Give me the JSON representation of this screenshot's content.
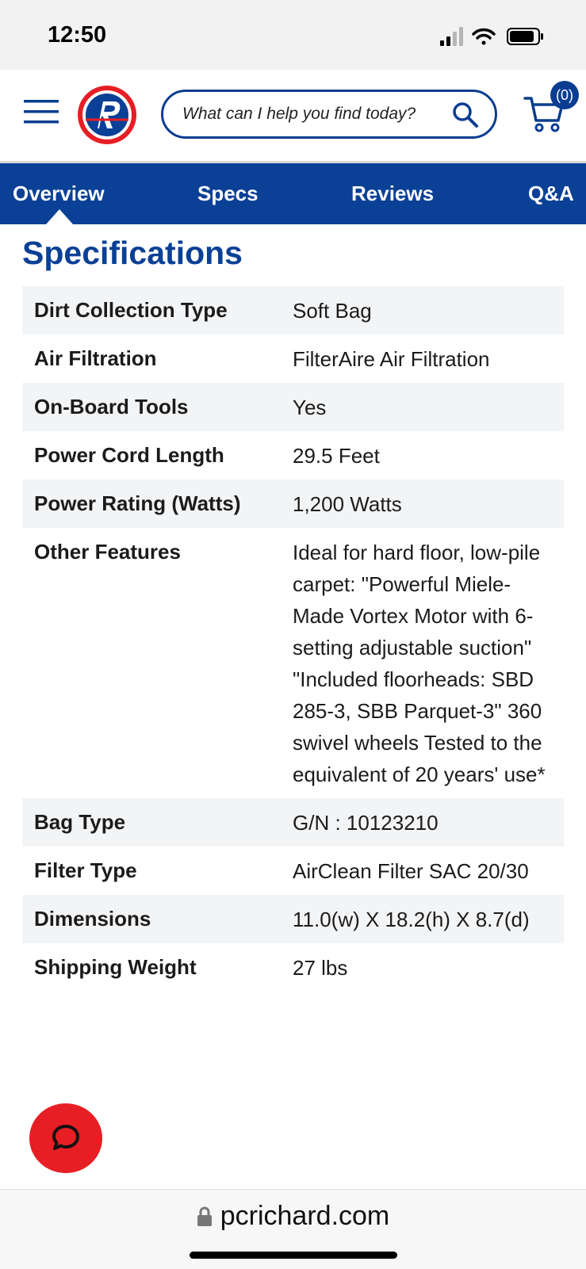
{
  "status_bar": {
    "time": "12:50"
  },
  "header": {
    "search_placeholder": "What can I help you find today?",
    "cart_count": "(0)"
  },
  "tabs": [
    {
      "label": "Overview"
    },
    {
      "label": "Specs"
    },
    {
      "label": "Reviews"
    },
    {
      "label": "Q&A"
    }
  ],
  "specs": {
    "title": "Specifications",
    "rows": [
      {
        "label": "Dirt Collection Type",
        "value": "Soft Bag"
      },
      {
        "label": "Air Filtration",
        "value": "FilterAire Air Filtration"
      },
      {
        "label": "On-Board Tools",
        "value": "Yes"
      },
      {
        "label": "Power Cord Length",
        "value": "29.5 Feet"
      },
      {
        "label": "Power Rating (Watts)",
        "value": "1,200 Watts"
      },
      {
        "label": "Other Features",
        "value": "Ideal for hard floor, low-pile carpet: \"Powerful Miele-Made Vortex Motor with 6-setting adjustable suction\" \"Included floorheads: SBD 285-3, SBB Parquet-3\" 360 swivel wheels Tested to the equivalent of 20 years' use*"
      },
      {
        "label": "Bag Type",
        "value": "G/N : 10123210"
      },
      {
        "label": "Filter Type",
        "value": "AirClean Filter SAC 20/30"
      },
      {
        "label": "Dimensions",
        "value": "11.0(w) X 18.2(h) X 8.7(d)"
      },
      {
        "label": "Shipping Weight",
        "value": "27 lbs"
      }
    ]
  },
  "browser": {
    "url": "pcrichard.com"
  },
  "colors": {
    "brand_blue": "#0a4096",
    "brand_red": "#e71e24",
    "row_shade": "#f3f4f6"
  }
}
